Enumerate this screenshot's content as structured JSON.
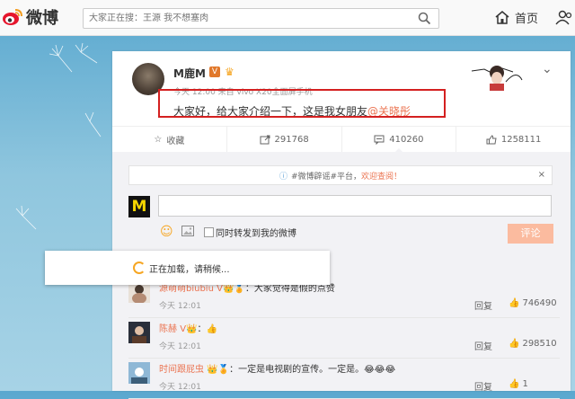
{
  "topbar": {
    "logo_text": "微博",
    "search_placeholder": "大家正在搜：王源 我不想塞肉",
    "home_label": "首页"
  },
  "post": {
    "username": "M鹿M",
    "verified_badge": "V",
    "meta": "今天 12:00 来自 vivo X20全面屏手机",
    "text_main": "大家好，给大家介绍一下，这是我女朋友",
    "mention": "@关晓彤",
    "actions": {
      "favorite": "收藏",
      "repost": "291768",
      "comment": "410260",
      "like": "1258111"
    }
  },
  "comment_box": {
    "notice_prefix": "#微博辟谣#平台，",
    "notice_link": "欢迎查阅！",
    "notice_close": "×",
    "my_avatar_text": "M",
    "repost_label": "同时转发到我的微博",
    "submit_label": "评论"
  },
  "loading_text": "正在加载，请稍候...",
  "comments": [
    {
      "name": "源萌萌biubiu",
      "badges": "V👑🏅",
      "text": "：大家觉得是假的点赞",
      "time": "今天 12:01",
      "reply": "回复",
      "likes": "746490"
    },
    {
      "name": "陈赫",
      "badges": "V👑",
      "text": "：👍",
      "time": "今天 12:01",
      "reply": "回复",
      "likes": "298510"
    },
    {
      "name": "时间跟屁虫",
      "badges": "👑🏅",
      "text": "：一定是电视剧的宣传。一定是。😂😂😂",
      "time": "今天 12:01",
      "reply": "回复",
      "likes": "1"
    }
  ],
  "colors": {
    "accent": "#eb7350",
    "highlight_border": "#d42020",
    "submit_bg": "#fbbb9f"
  }
}
